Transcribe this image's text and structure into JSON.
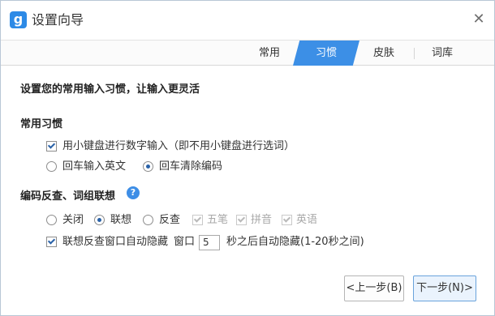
{
  "window": {
    "title": "设置向导",
    "logo_char": "g",
    "close_glyph": "✕"
  },
  "tabs": [
    {
      "label": "常用",
      "active": false
    },
    {
      "label": "习惯",
      "active": true
    },
    {
      "label": "皮肤",
      "active": false
    },
    {
      "label": "词库",
      "active": false
    }
  ],
  "content": {
    "heading": "设置您的常用输入习惯，让输入更灵活",
    "habits": {
      "title": "常用习惯",
      "numpad_checkbox": {
        "label": "用小键盘进行数字输入（即不用小键盘进行选词）",
        "checked": true
      },
      "enter_english": {
        "label": "回车输入英文",
        "selected": false
      },
      "enter_clear": {
        "label": "回车清除编码",
        "selected": true
      }
    },
    "reverse": {
      "title": "编码反查、词组联想",
      "help_glyph": "?",
      "off": {
        "label": "关闭",
        "selected": false
      },
      "association": {
        "label": "联想",
        "selected": true
      },
      "lookup": {
        "label": "反查",
        "selected": false
      },
      "wubi": {
        "label": "五笔",
        "checked": true,
        "enabled": false
      },
      "pinyin": {
        "label": "拼音",
        "checked": true,
        "enabled": false
      },
      "english": {
        "label": "英语",
        "checked": true,
        "enabled": false
      },
      "auto_hide": {
        "label": "联想反查窗口自动隐藏",
        "checked": true
      },
      "window_label": "窗口",
      "seconds_value": "5",
      "seconds_suffix": "秒之后自动隐藏(1-20秒之间)"
    }
  },
  "buttons": {
    "prev": "<上一步(B)",
    "next": "下一步(N)>"
  },
  "colors": {
    "accent": "#3c8fe6",
    "logo": "#2d8ae6",
    "check": "#2a62a8"
  }
}
